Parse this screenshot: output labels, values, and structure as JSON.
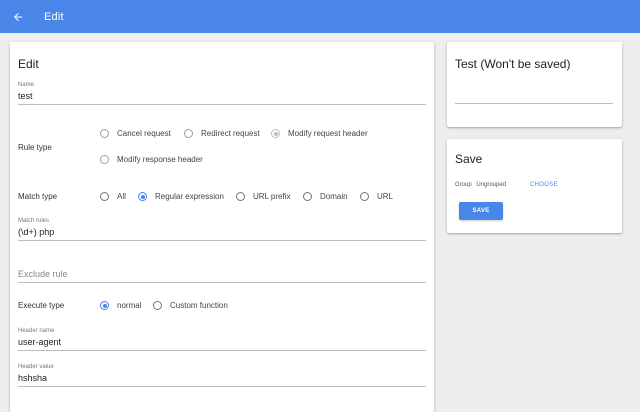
{
  "appbar": {
    "title": "Edit",
    "back_icon": "arrow-back-icon",
    "color": "#4a86e8"
  },
  "main": {
    "title": "Edit",
    "name": {
      "label": "Name",
      "value": "test"
    },
    "rule_type": {
      "label": "Rule type",
      "options": [
        "Cancel request",
        "Redirect request",
        "Modify request header",
        "Modify response header"
      ],
      "selected": "Modify request header"
    },
    "match_type": {
      "label": "Match type",
      "options": [
        "All",
        "Regular expression",
        "URL prefix",
        "Domain",
        "URL"
      ],
      "selected": "Regular expression"
    },
    "match_rules": {
      "label": "Match rules",
      "value": "(\\d+) php"
    },
    "exclude_rule": {
      "placeholder": "Exclude rule"
    },
    "execute_type": {
      "label": "Execute type",
      "options": [
        "normal",
        "Custom function"
      ],
      "selected": "normal"
    },
    "header_name": {
      "label": "Header name",
      "value": "user-agent"
    },
    "header_value": {
      "label": "Header value",
      "value": "hshsha"
    }
  },
  "test_card": {
    "title": "Test (Won't be saved)"
  },
  "save_card": {
    "title": "Save",
    "group_label": "Group",
    "group_value": "Ungrouped",
    "choose_label": "CHOOSE",
    "save_label": "SAVE"
  },
  "colors": {
    "accent": "#4285f4",
    "background": "#eeeeee"
  }
}
